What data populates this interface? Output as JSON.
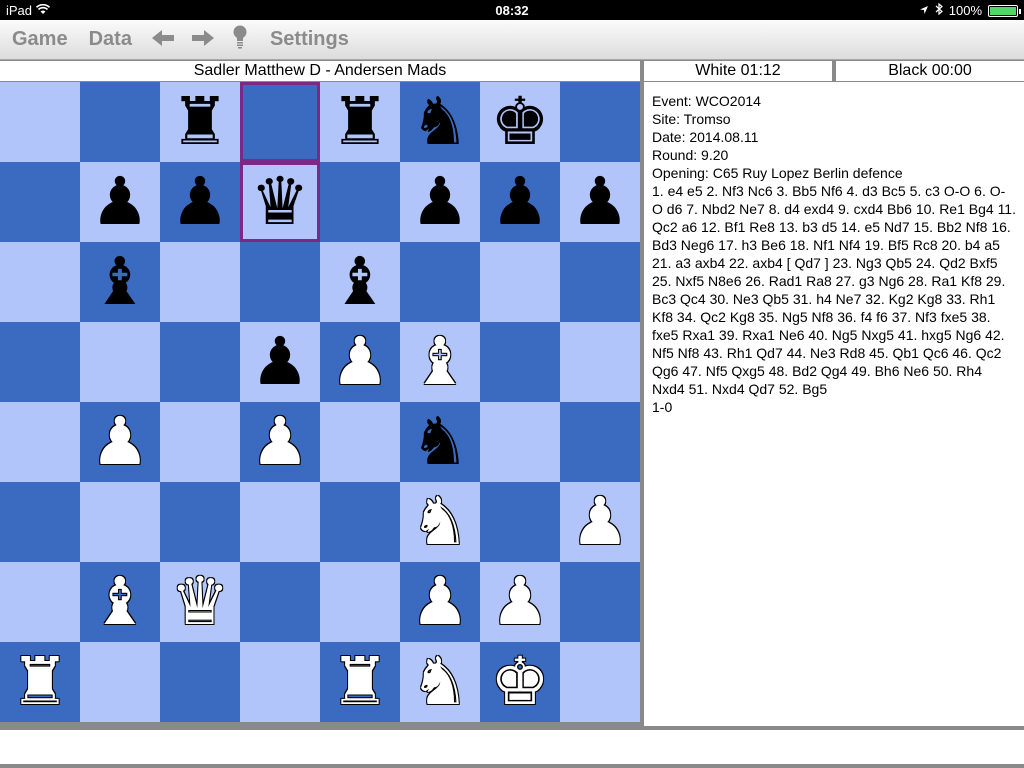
{
  "status_bar": {
    "device": "iPad",
    "time": "08:32",
    "battery": "100%"
  },
  "toolbar": {
    "game": "Game",
    "data": "Data",
    "back_icon": "arrow-left-icon",
    "forward_icon": "arrow-right-icon",
    "hint_icon": "lightbulb-icon",
    "settings": "Settings"
  },
  "header": {
    "players": "Sadler Matthew D - Andersen Mads",
    "white_clock": "White 01:12",
    "black_clock": "Black 00:00"
  },
  "board": {
    "highlighted": [
      "d8",
      "d7"
    ],
    "pieces": {
      "c8": "bR",
      "e8": "bR",
      "f8": "bN",
      "g8": "bK",
      "b7": "bP",
      "c7": "bP",
      "d7": "bQ",
      "f7": "bP",
      "g7": "bP",
      "h7": "bP",
      "b6": "bB",
      "e6": "bB",
      "d5": "bP",
      "e5": "wP",
      "f5": "wB",
      "b4": "wP",
      "d4": "wP",
      "f4": "bN",
      "f3": "wN",
      "h3": "wP",
      "b2": "wB",
      "c2": "wQ",
      "f2": "wP",
      "g2": "wP",
      "a1": "wR",
      "e1": "wR",
      "f1": "wN",
      "g1": "wK"
    }
  },
  "game_info": {
    "event": "Event: WCO2014",
    "site": "Site: Tromso",
    "date": "Date: 2014.08.11",
    "round": "Round: 9.20",
    "opening": "Opening: C65 Ruy Lopez Berlin defence",
    "moves": [
      "1. e4 e5 2. Nf3 Nc6 3. Bb5 Nf6 4. d3 Bc5 5. c3 O-O 6. O-",
      "O d6 7. Nbd2 Ne7 8. d4 exd4 9. cxd4 Bb6 10. Re1 Bg4 11.",
      "Qc2 a6 12. Bf1 Re8 13. b3 d5 14. e5 Nd7 15. Bb2 Nf8 16.",
      "Bd3 Neg6 17. h3 Be6 18. Nf1 Nf4 19. Bf5 Rc8 20. b4 a5",
      "21. a3 axb4 22. axb4 [ Qd7 ] 23. Ng3 Qb5 24. Qd2 Bxf5",
      "25. Nxf5 N8e6 26. Rad1 Ra8 27. g3 Ng6 28. Ra1 Kf8 29.",
      "Bc3 Qc4 30. Ne3 Qb5 31. h4 Ne7 32. Kg2 Kg8 33. Rh1",
      "Kf8 34. Qc2 Kg8 35. Ng5 Nf8 36. f4 f6 37. Nf3 fxe5 38.",
      "fxe5 Rxa1 39. Rxa1 Ne6 40. Ng5 Nxg5 41. hxg5 Ng6 42.",
      "Nf5 Nf8 43. Rh1 Qd7 44. Ne3 Rd8 45. Qb1 Qc6 46. Qc2",
      "Qg6 47. Nf5 Qxg5 48. Bd2 Qg4 49. Bh6 Ne6 50. Rh4",
      "Nxd4 51. Nxd4 Qd7 52. Bg5"
    ],
    "result": "1-0"
  }
}
